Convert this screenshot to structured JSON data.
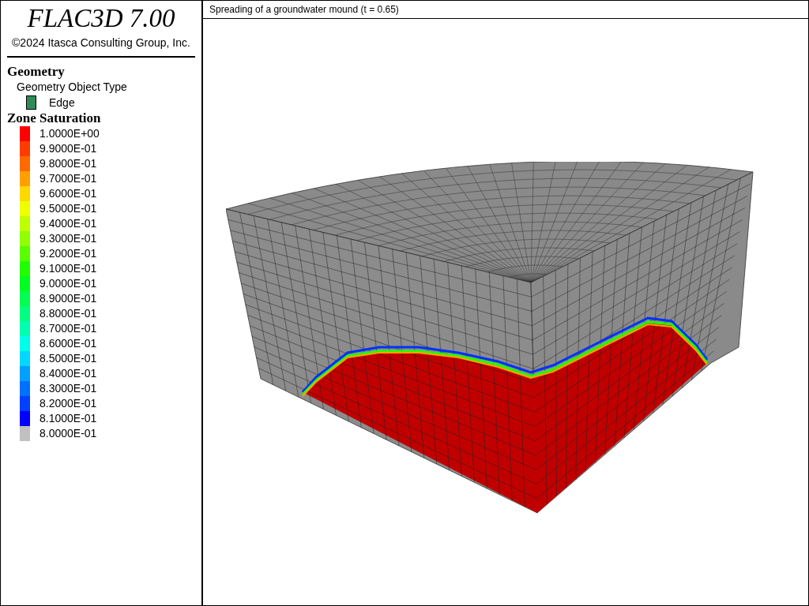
{
  "legend": {
    "app_title": "FLAC3D 7.00",
    "copyright": "©2024 Itasca Consulting Group, Inc.",
    "sections": [
      {
        "kind": "geometry",
        "title": "Geometry",
        "subtitle": "Geometry Object Type",
        "items": [
          {
            "label": "Edge",
            "color": "#2e8b57"
          }
        ]
      },
      {
        "kind": "contour",
        "title": "Zone Saturation",
        "items": [
          {
            "label": "1.0000E+00",
            "color": "#ff0000"
          },
          {
            "label": "9.9000E-01",
            "color": "#ff3c00"
          },
          {
            "label": "9.8000E-01",
            "color": "#ff6a00"
          },
          {
            "label": "9.7000E-01",
            "color": "#ffa000"
          },
          {
            "label": "9.6000E-01",
            "color": "#ffd800"
          },
          {
            "label": "9.5000E-01",
            "color": "#f0ff00"
          },
          {
            "label": "9.4000E-01",
            "color": "#c0ff00"
          },
          {
            "label": "9.3000E-01",
            "color": "#90ff00"
          },
          {
            "label": "9.2000E-01",
            "color": "#5aff00"
          },
          {
            "label": "9.1000E-01",
            "color": "#20ff00"
          },
          {
            "label": "9.0000E-01",
            "color": "#00ff20"
          },
          {
            "label": "8.9000E-01",
            "color": "#00ff50"
          },
          {
            "label": "8.8000E-01",
            "color": "#00ff80"
          },
          {
            "label": "8.7000E-01",
            "color": "#00ffb0"
          },
          {
            "label": "8.6000E-01",
            "color": "#00ffe8"
          },
          {
            "label": "8.5000E-01",
            "color": "#00d8ff"
          },
          {
            "label": "8.4000E-01",
            "color": "#00a0ff"
          },
          {
            "label": "8.3000E-01",
            "color": "#0070ff"
          },
          {
            "label": "8.2000E-01",
            "color": "#0040ff"
          },
          {
            "label": "8.1000E-01",
            "color": "#0000ff"
          },
          {
            "label": "8.0000E-01",
            "color": "#c0c0c0"
          }
        ]
      }
    ]
  },
  "plot": {
    "title": "Spreading of a groundwater mound (t = 0.65)"
  }
}
